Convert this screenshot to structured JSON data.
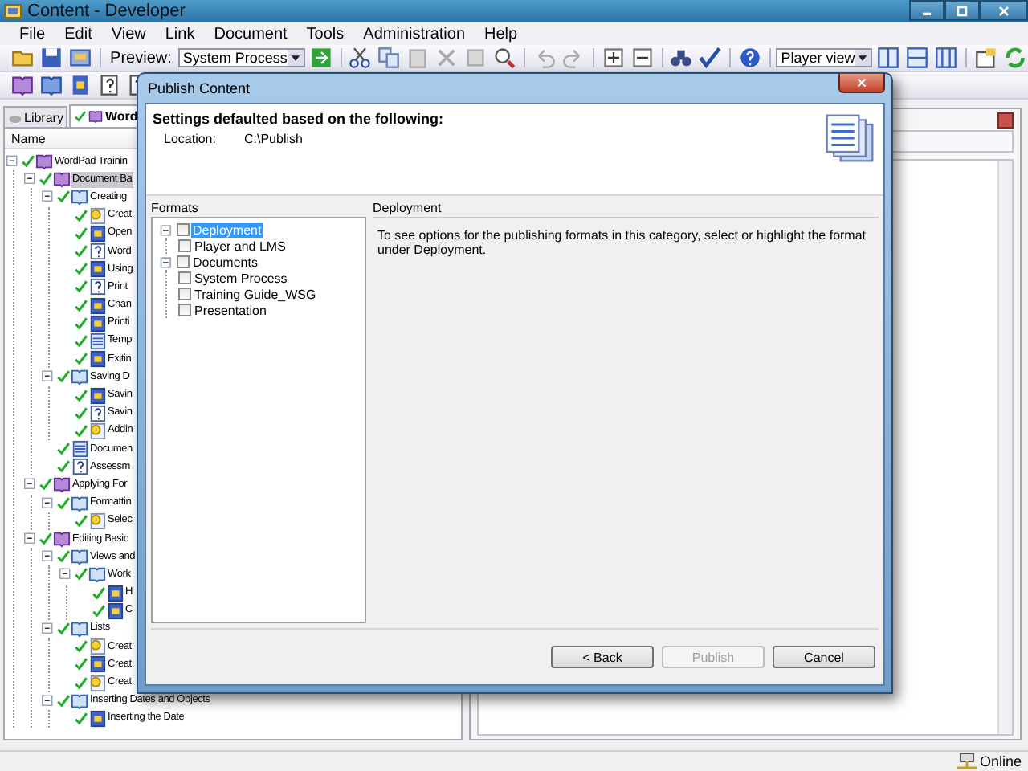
{
  "window": {
    "title": "Content - Developer"
  },
  "menu": [
    "File",
    "Edit",
    "View",
    "Link",
    "Document",
    "Tools",
    "Administration",
    "Help"
  ],
  "toolbar": {
    "preview_label": "Preview:",
    "preview_value": "System Process",
    "view_value": "Player view"
  },
  "tabs": [
    {
      "label": "Library",
      "selected": false
    },
    {
      "label": "Word",
      "selected": true
    }
  ],
  "tree": {
    "column": "Name",
    "items": [
      {
        "label": "WordPad Trainin",
        "kind": "module",
        "selected": false,
        "children": [
          {
            "label": "Document Ba",
            "kind": "module",
            "selected": true,
            "children": [
              {
                "label": "Creating",
                "kind": "section",
                "selected": false,
                "children": [
                  {
                    "label": "Creat",
                    "kind": "topic",
                    "selected": false
                  },
                  {
                    "label": "Open",
                    "kind": "doc-topic",
                    "selected": false
                  },
                  {
                    "label": "Word",
                    "kind": "question",
                    "selected": false
                  },
                  {
                    "label": "Using",
                    "kind": "doc-topic",
                    "selected": false
                  },
                  {
                    "label": "Print",
                    "kind": "question",
                    "selected": false
                  },
                  {
                    "label": "Chan",
                    "kind": "doc-topic",
                    "selected": false
                  },
                  {
                    "label": "Printi",
                    "kind": "doc-topic",
                    "selected": false
                  },
                  {
                    "label": "Temp",
                    "kind": "doc",
                    "selected": false
                  },
                  {
                    "label": "Exitin",
                    "kind": "doc-topic",
                    "selected": false
                  }
                ]
              },
              {
                "label": "Saving D",
                "kind": "section",
                "selected": false,
                "children": [
                  {
                    "label": "Savin",
                    "kind": "doc-topic",
                    "selected": false
                  },
                  {
                    "label": "Savin",
                    "kind": "question",
                    "selected": false
                  },
                  {
                    "label": "Addin",
                    "kind": "topic",
                    "selected": false
                  }
                ]
              },
              {
                "label": "Documen",
                "kind": "doc",
                "selected": false
              },
              {
                "label": "Assessm",
                "kind": "question",
                "selected": false
              }
            ]
          },
          {
            "label": "Applying For",
            "kind": "module",
            "selected": false,
            "children": [
              {
                "label": "Formattin",
                "kind": "section",
                "selected": false,
                "children": [
                  {
                    "label": "Selec",
                    "kind": "topic",
                    "selected": false
                  }
                ]
              }
            ]
          },
          {
            "label": "Editing Basic",
            "kind": "module",
            "selected": false,
            "children": [
              {
                "label": "Views and",
                "kind": "section",
                "selected": false,
                "children": [
                  {
                    "label": "Work",
                    "kind": "section",
                    "selected": false,
                    "children": [
                      {
                        "label": "H",
                        "kind": "doc-topic",
                        "selected": false
                      },
                      {
                        "label": "C",
                        "kind": "doc-topic",
                        "selected": false
                      }
                    ]
                  }
                ]
              },
              {
                "label": "Lists",
                "kind": "section",
                "selected": false,
                "children": [
                  {
                    "label": "Creat",
                    "kind": "topic",
                    "selected": false
                  },
                  {
                    "label": "Creat",
                    "kind": "doc-topic",
                    "selected": false
                  },
                  {
                    "label": "Creat",
                    "kind": "topic",
                    "selected": false
                  }
                ]
              },
              {
                "label": "Inserting Dates and Objects",
                "kind": "section",
                "selected": false,
                "children": [
                  {
                    "label": "Inserting the Date",
                    "kind": "doc-topic",
                    "selected": false
                  }
                ]
              }
            ]
          }
        ]
      }
    ]
  },
  "dialog": {
    "title": "Publish Content",
    "heading": "Settings defaulted based on the following:",
    "location_label": "Location:",
    "location_value": "C:\\Publish",
    "formats_label": "Formats",
    "formats": [
      {
        "label": "Deployment",
        "selected": true,
        "checked": false,
        "children": [
          {
            "label": "Player and LMS",
            "selected": false,
            "checked": false
          }
        ]
      },
      {
        "label": "Documents",
        "selected": false,
        "checked": false,
        "children": [
          {
            "label": "System Process",
            "selected": false,
            "checked": false
          },
          {
            "label": "Training Guide_WSG",
            "selected": false,
            "checked": false
          },
          {
            "label": "Presentation",
            "selected": false,
            "checked": false
          }
        ]
      }
    ],
    "detail_title": "Deployment",
    "detail_text": "To see options for the publishing formats in this category, select or highlight the format under Deployment.",
    "buttons": [
      {
        "label": "< Back",
        "disabled": false
      },
      {
        "label": "Publish",
        "disabled": true
      },
      {
        "label": "Cancel",
        "disabled": false
      }
    ]
  },
  "status": {
    "text": "Online"
  }
}
